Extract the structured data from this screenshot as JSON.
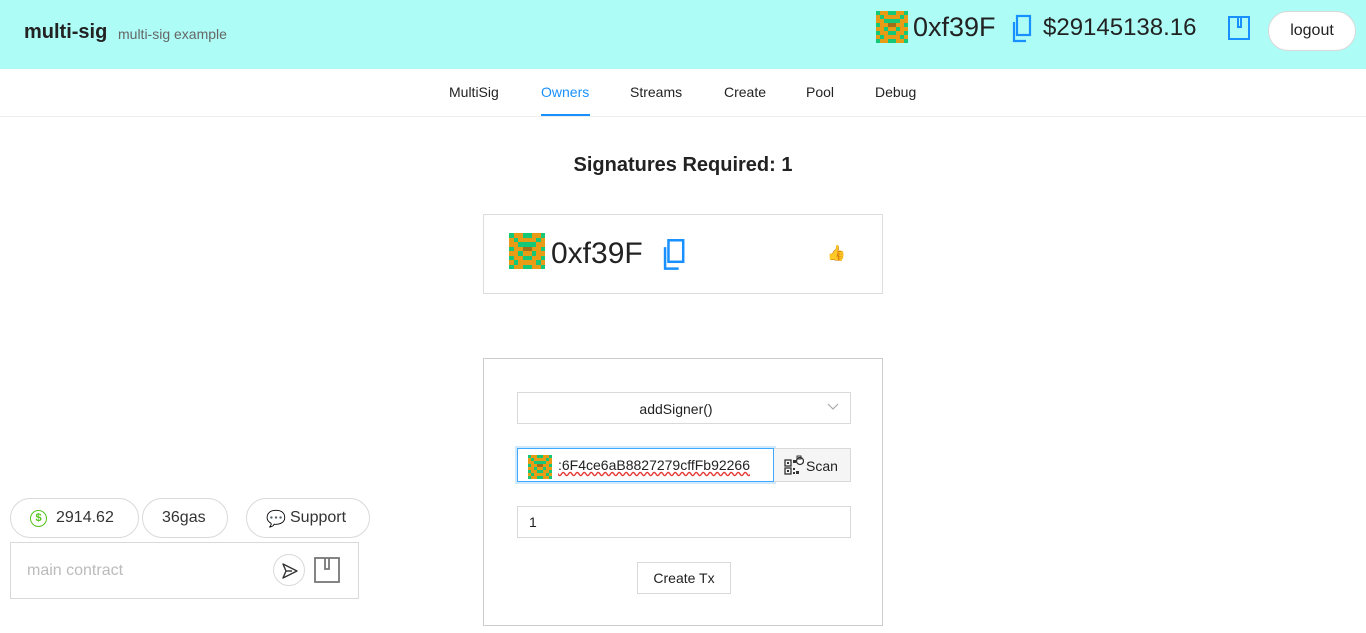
{
  "app": {
    "title": "multi-sig",
    "subtitle": "multi-sig example"
  },
  "account": {
    "address": "0xf39F",
    "balance": "$29145138.16",
    "logout_label": "logout"
  },
  "nav": {
    "items": [
      {
        "label": "MultiSig"
      },
      {
        "label": "Owners"
      },
      {
        "label": "Streams"
      },
      {
        "label": "Create"
      },
      {
        "label": "Pool"
      },
      {
        "label": "Debug"
      }
    ],
    "active": "Owners"
  },
  "owners": {
    "signatures_label": "Signatures Required: 1",
    "list": [
      {
        "address": "0xf39F",
        "icon": "thumbs-up-icon"
      }
    ]
  },
  "form": {
    "method": "addSigner()",
    "address_value": ":6F4ce6aB8827279cffFb92266",
    "scan_label": "Scan",
    "amount_value": "1",
    "create_label": "Create Tx"
  },
  "footer": {
    "eth_balance": "2914.62",
    "gas": "36gas",
    "support_label": "Support",
    "contract_placeholder": "main contract"
  },
  "colors": {
    "header_bg": "#aefcf6",
    "accent": "#1890ff",
    "blockie_orange": "#e89b15",
    "blockie_green": "#14c878",
    "success": "#52c41a"
  }
}
